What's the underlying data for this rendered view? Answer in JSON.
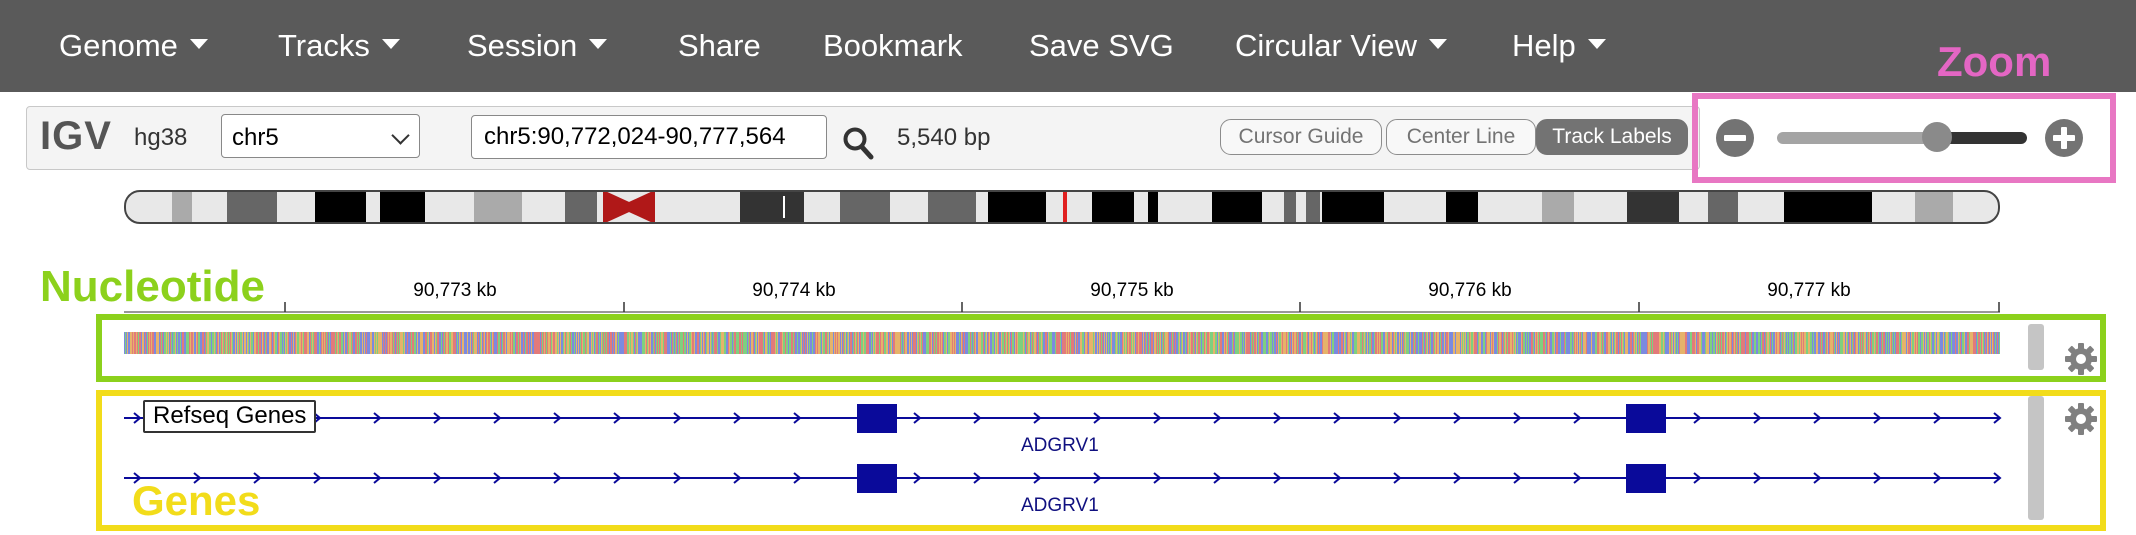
{
  "menubar": {
    "items": [
      {
        "label": "Genome",
        "dropdown": true
      },
      {
        "label": "Tracks",
        "dropdown": true
      },
      {
        "label": "Session",
        "dropdown": true
      },
      {
        "label": "Share",
        "dropdown": false
      },
      {
        "label": "Bookmark",
        "dropdown": false
      },
      {
        "label": "Save SVG",
        "dropdown": false
      },
      {
        "label": "Circular View",
        "dropdown": true
      },
      {
        "label": "Help",
        "dropdown": true
      }
    ]
  },
  "controls": {
    "logo": "IGV",
    "genome": "hg38",
    "chromosome": "chr5",
    "locus": "chr5:90,772,024-90,777,564",
    "width_label": "5,540 bp",
    "cursor_guide": "Cursor Guide",
    "center_line": "Center Line",
    "track_labels": "Track Labels",
    "zoom_level_fraction": 0.64
  },
  "annotations": {
    "zoom": "Zoom",
    "nucleotide": "Nucleotide",
    "genes": "Genes"
  },
  "ruler": {
    "ticks": [
      "90,773 kb",
      "90,774 kb",
      "90,775 kb",
      "90,776 kb",
      "90,777 kb"
    ]
  },
  "tracks": {
    "refseq_label": "Refseq Genes",
    "gene_name_1": "ADGRV1",
    "gene_name_2": "ADGRV1"
  },
  "colors": {
    "menubar": "#5a5a5a",
    "zoom_box": "#e877c3",
    "nucleotide_box": "#8cd11c",
    "genes_box": "#f2dc1a",
    "gene": "#0a0a9a",
    "centromere": "#b01818",
    "current_region": "#e02020"
  },
  "icons": [
    "search-icon",
    "zoom-out-icon",
    "zoom-in-icon",
    "gear-icon",
    "chevron-down-icon"
  ]
}
